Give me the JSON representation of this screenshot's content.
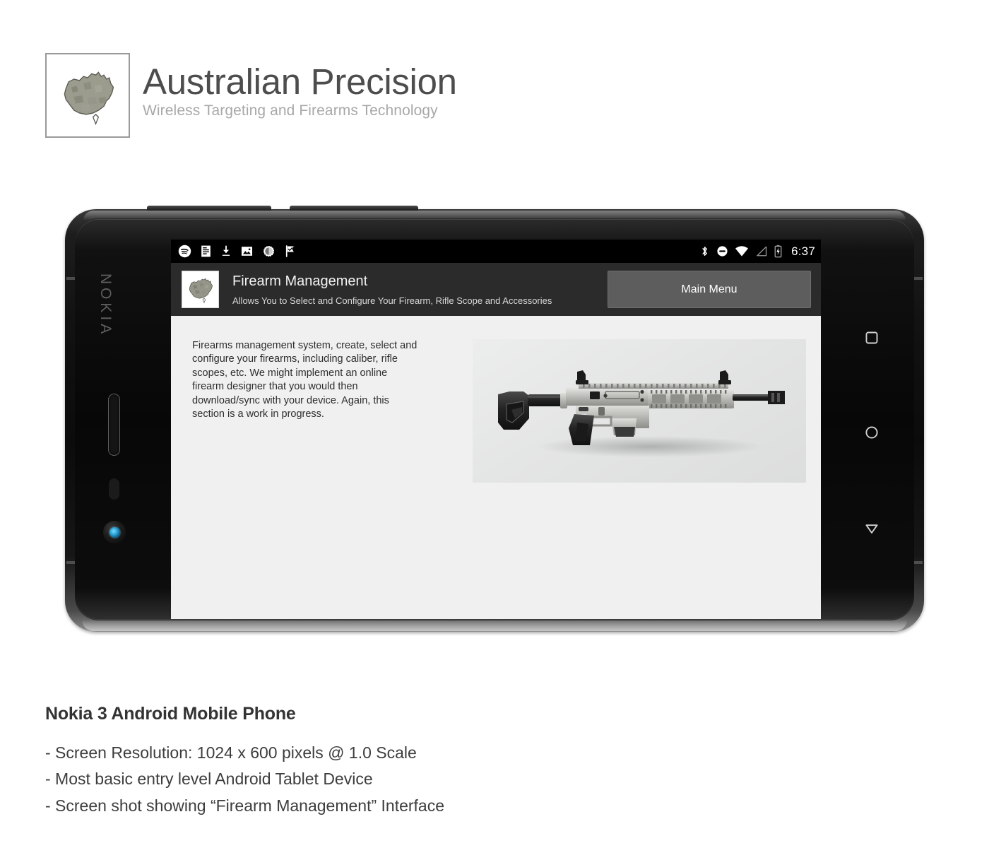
{
  "brand": {
    "title": "Australian Precision",
    "subtitle": "Wireless Targeting and Firearms Technology",
    "logo_icon": "australia-map-icon"
  },
  "phone": {
    "device_mark": "NOKIA",
    "hardware": {
      "volume_button": "volume-rocker",
      "power_button": "power-button",
      "earpiece": "earpiece-speaker",
      "proximity_sensor": "proximity-sensor",
      "front_camera": "front-camera"
    },
    "status_bar": {
      "clock": "6:37",
      "left_icons": [
        "spotify-icon",
        "notes-list-icon",
        "download-icon",
        "image-icon",
        "sync-progress-icon",
        "checkmark-flag-icon"
      ],
      "right_icons": [
        "bluetooth-icon",
        "do-not-disturb-icon",
        "wifi-icon",
        "cell-signal-icon",
        "battery-charging-icon"
      ]
    },
    "app": {
      "logo_icon": "australia-map-icon",
      "title": "Firearm Management",
      "subtitle": "Allows You to Select and Configure Your Firearm, Rifle Scope and Accessories",
      "main_menu_label": "Main Menu",
      "body_text": "Firearms management system, create, select and configure your firearms, including caliber, rifle scopes, etc. We might implement an online firearm designer that you would then download/sync with your device. Again, this section is a work in progress.",
      "image_alt": "semi-automatic-rifle-image"
    },
    "nav_bar": {
      "recents": "square-recents-icon",
      "home": "circle-home-icon",
      "back": "triangle-back-icon"
    }
  },
  "caption": {
    "title": "Nokia 3 Android Mobile Phone",
    "lines": [
      "- Screen Resolution: 1024 x 600 pixels @ 1.0 Scale",
      "- Most basic entry level Android Tablet Device",
      "- Screen shot showing “Firearm Management” Interface"
    ]
  },
  "colors": {
    "page_background": "#ffffff",
    "brand_title": "#4d4d4d",
    "brand_subtitle": "#a8a8a8",
    "app_header": "#2b2b2b",
    "main_menu_button": "#5d5d5d",
    "content_background": "#f0f0f0",
    "status_bar": "#000000"
  }
}
